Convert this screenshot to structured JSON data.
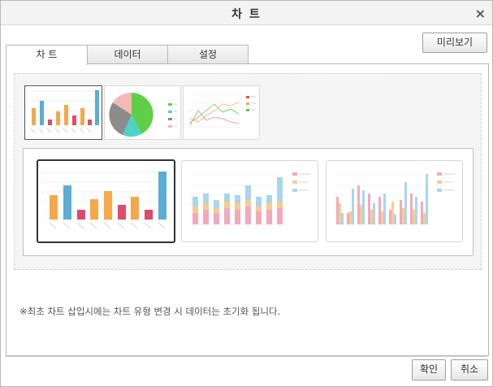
{
  "dialog": {
    "title": "차 트",
    "close_symbol": "×",
    "preview_label": "미리보기"
  },
  "tabs": [
    {
      "label": "차 트",
      "active": true
    },
    {
      "label": "데이터",
      "active": false
    },
    {
      "label": "설정",
      "active": false
    }
  ],
  "chart_types": [
    {
      "name": "bar",
      "selected": true
    },
    {
      "name": "pie",
      "selected": false
    },
    {
      "name": "line",
      "selected": false
    }
  ],
  "bar_styles": [
    {
      "name": "basic",
      "selected": true
    },
    {
      "name": "stacked",
      "selected": false
    },
    {
      "name": "grouped",
      "selected": false
    }
  ],
  "colors": {
    "orange": "#f5a84a",
    "blue": "#5aaed6",
    "red": "#e04a6a",
    "green": "#5fcf48",
    "teal": "#4fd3c8",
    "gray": "#8c8c8c",
    "pink": "#f4b8b5",
    "pink_light": "#f2a9bd",
    "orange_light": "#f7cc8f",
    "blue_light": "#a9d6ea"
  },
  "notice": "※최초 차트 삽입시에는 차트 유형 변경 시 데이터는 초기화 됩니다.",
  "footer": {
    "ok_label": "확인",
    "cancel_label": "취소"
  }
}
